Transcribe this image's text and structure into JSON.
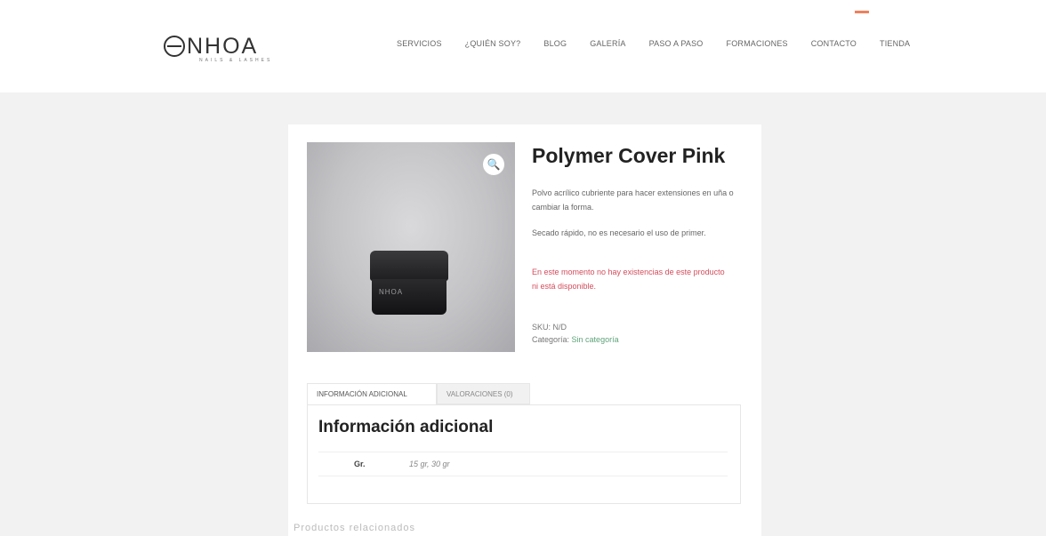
{
  "brand": {
    "name": "NHOA",
    "tagline": "NAILS & LASHES"
  },
  "nav": {
    "items": [
      "Servicios",
      "¿Quién soy?",
      "Blog",
      "Galería",
      "Paso a paso",
      "Formaciones",
      "Contacto",
      "Tienda"
    ]
  },
  "product": {
    "title": "Polymer Cover Pink",
    "description": "Polvo acrílico cubriente para hacer extensiones en uña o cambiar la forma.",
    "description2": "Secado rápido, no es necesario el uso de primer.",
    "stock_message": "En este momento no hay existencias de este producto ni está disponible.",
    "sku_label": "SKU:",
    "sku_value": "N/D",
    "category_label": "Categoría:",
    "category_value": "Sin categoría",
    "image_label": "NHOA"
  },
  "tabs": {
    "info": "Información adicional",
    "reviews": "Valoraciones (0)"
  },
  "additional_info": {
    "heading": "Información adicional",
    "attr_name": "Gr.",
    "attr_value": "15 gr, 30 gr"
  },
  "related": {
    "label": "Productos relacionados"
  },
  "colors": {
    "accent": "#f0805c",
    "stock_red": "#d44d5c",
    "category_green": "#5fa37a"
  },
  "icons": {
    "zoom": "magnifier-icon"
  }
}
